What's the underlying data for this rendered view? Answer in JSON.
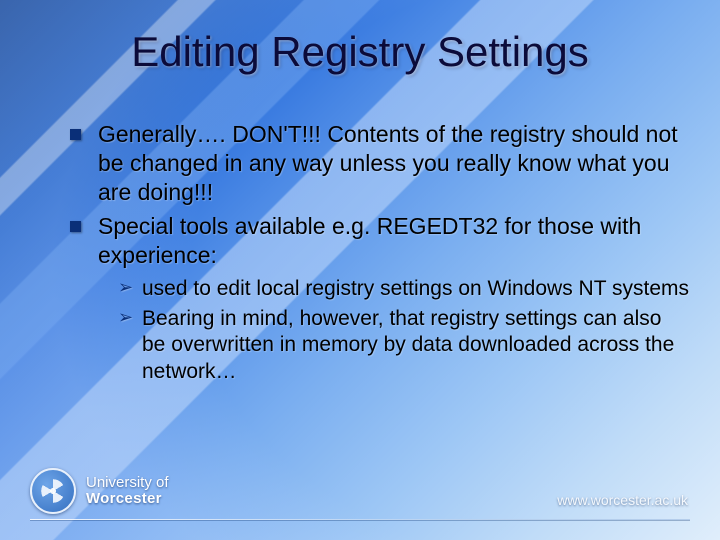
{
  "title": "Editing Registry Settings",
  "bullets": {
    "b0": "Generally…. DON'T!!! Contents of the registry should not be changed in any way unless you really know what you are doing!!!",
    "b1": "Special tools available e.g. REGEDT32 for those with experience:"
  },
  "subbullets": {
    "s0": "used to edit local registry settings on Windows NT systems",
    "s1": "Bearing in mind, however, that registry settings can also be overwritten in memory by data downloaded across the network…"
  },
  "footer": {
    "logo_line1": "University of",
    "logo_line2": "Worcester",
    "url": "www.worcester.ac.uk"
  }
}
